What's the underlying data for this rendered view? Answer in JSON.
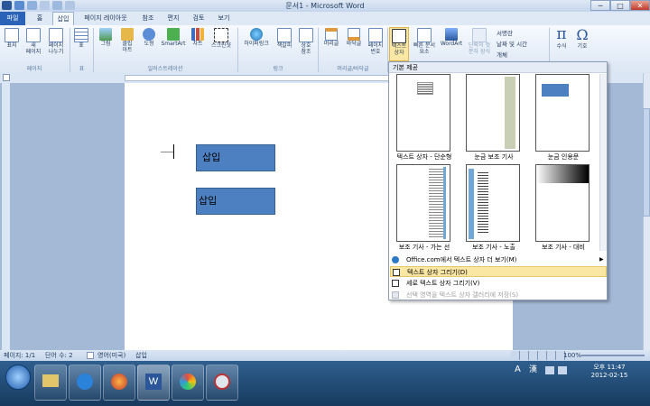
{
  "window": {
    "title": "문서1 - Microsoft Word",
    "minimize_label": "─",
    "maximize_label": "□",
    "close_label": "✕"
  },
  "tabs": [
    {
      "label": "파일"
    },
    {
      "label": "홈"
    },
    {
      "label": "삽입"
    },
    {
      "label": "페이지 레이아웃"
    },
    {
      "label": "참조"
    },
    {
      "label": "편지"
    },
    {
      "label": "검토"
    },
    {
      "label": "보기"
    }
  ],
  "ribbon": {
    "buttons": [
      {
        "label": "표지"
      },
      {
        "label": "새\n페이지"
      },
      {
        "label": "페이지\n나누기"
      },
      {
        "label": "표"
      },
      {
        "label": "그림"
      },
      {
        "label": "클립\n아트"
      },
      {
        "label": "도형"
      },
      {
        "label": "SmartArt"
      },
      {
        "label": "차트"
      },
      {
        "label": "스크린샷"
      },
      {
        "label": "하이퍼링크"
      },
      {
        "label": "책갈피"
      },
      {
        "label": "상호\n참조"
      },
      {
        "label": "머리글"
      },
      {
        "label": "바닥글"
      },
      {
        "label": "페이지\n번호"
      },
      {
        "label": "텍스트\n상자"
      },
      {
        "label": "빠른 문서\n요소"
      },
      {
        "label": "WordArt"
      },
      {
        "label": "단락의 첫\n문자 장식"
      },
      {
        "label": "수식"
      },
      {
        "label": "기호"
      }
    ],
    "small_buttons": [
      {
        "label": "서명란"
      },
      {
        "label": "날짜 및 시간"
      },
      {
        "label": "개체"
      }
    ],
    "groups": [
      {
        "label": "페이지"
      },
      {
        "label": "표"
      },
      {
        "label": "일러스트레이션"
      },
      {
        "label": "링크"
      },
      {
        "label": "머리글/바닥글"
      }
    ]
  },
  "document": {
    "shapes": [
      {
        "text": "삽입"
      },
      {
        "text": "삽입"
      }
    ]
  },
  "textbox_menu": {
    "header": "기본 제공",
    "thumbnails": [
      {
        "caption": "텍스트 상자 - 단순형"
      },
      {
        "caption": "눈금 보조 기사"
      },
      {
        "caption": "눈금 인용문"
      },
      {
        "caption": "보조 기사 - 가는 선"
      },
      {
        "caption": "보조 기사 - 노출"
      },
      {
        "caption": "보조 기사 - 대비"
      }
    ],
    "items": [
      {
        "label": "Office.com에서 텍스트 상자 더 보기(M)",
        "arrow": "▶"
      },
      {
        "label": "텍스트 상자 그리기(D)"
      },
      {
        "label": "세로 텍스트 상자 그리기(V)"
      },
      {
        "label": "선택 영역을 텍스트 상자 갤러리에 저장(S)"
      }
    ]
  },
  "status": {
    "page": "페이지: 1/1",
    "words": "단어 수: 2",
    "language": "영어(미국)",
    "mode": "삽입",
    "zoom": "100%"
  },
  "tray": {
    "time": "오후 11:47",
    "date": "2012-02-15",
    "ime": "A",
    "ime2": "漢"
  },
  "colors": {
    "accent": "#2b579a",
    "file_tab": "#2a63b8",
    "shape_fill": "#4d80c1",
    "highlight": "#fbe7a4"
  }
}
